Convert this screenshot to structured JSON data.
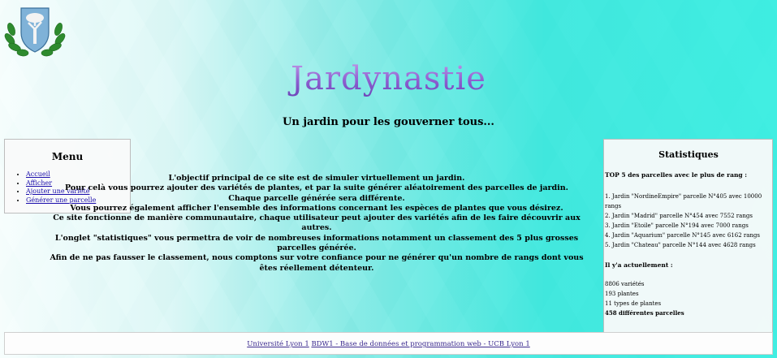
{
  "site": {
    "title": "Jardynastie",
    "subtitle": "Un jardin pour les gouverner tous..."
  },
  "menu": {
    "heading": "Menu",
    "items": [
      {
        "label": "Accueil"
      },
      {
        "label": "Afficher"
      },
      {
        "label": "Ajouter une variété"
      },
      {
        "label": "Générer une parcelle"
      }
    ]
  },
  "intro": {
    "lines": [
      "L'objectif principal de ce site est de simuler virtuellement un jardin.",
      "Pour celà vous pourrez ajouter des variétés de plantes, et par la suite générer aléatoirement des parcelles de jardin.",
      "Chaque parcelle générée sera différente.",
      "Vous pourrez également afficher l'ensemble des informations concernant les espèces de plantes que vous désirez.",
      "Ce site fonctionne de manière communautaire, chaque utilisateur peut ajouter des variétés afin de les faire découvrir aux autres.",
      "L'onglet \"statistiques\" vous permettra de voir de nombreuses informations notamment un classement des 5 plus grosses parcelles générée.",
      "Afin de ne pas fausser le classement, nous comptons sur votre confiance pour ne générer qu'un nombre de rangs dont vous êtes réellement détenteur."
    ]
  },
  "stats": {
    "heading": "Statistiques",
    "top_heading": "TOP 5 des parcelles avec le plus de rang :",
    "top": [
      "1. Jardin \"NordineEmpire\" parcelle N°405 avec 10000 rangs",
      "2. Jardin \"Madrid\" parcelle N°454 avec 7552 rangs",
      "3. Jardin \"Etoile\" parcelle N°194 avec 7000 rangs",
      "4. Jardin \"Aquarium\" parcelle N°145 avec 6162 rangs",
      "5. Jardin \"Chateau\" parcelle N°144 avec 4628 rangs"
    ],
    "current_heading": "Il y'a actuellement :",
    "varieties": "8806 variétés",
    "plants": "193 plantes",
    "types": "11 types de plantes",
    "parcels": "458 différentes parcelles"
  },
  "footer": {
    "link1": "Université Lyon 1",
    "link2": "BDW1 - Base de données et programmation web - UCB Lyon 1"
  },
  "colors": {
    "title_gradient_top": "#c49be8",
    "title_gradient_bottom": "#6d45b8",
    "link": "#1a0dab",
    "background_accent": "#3ce8de"
  },
  "icons": {
    "logo": "shield-laurel-logo"
  }
}
